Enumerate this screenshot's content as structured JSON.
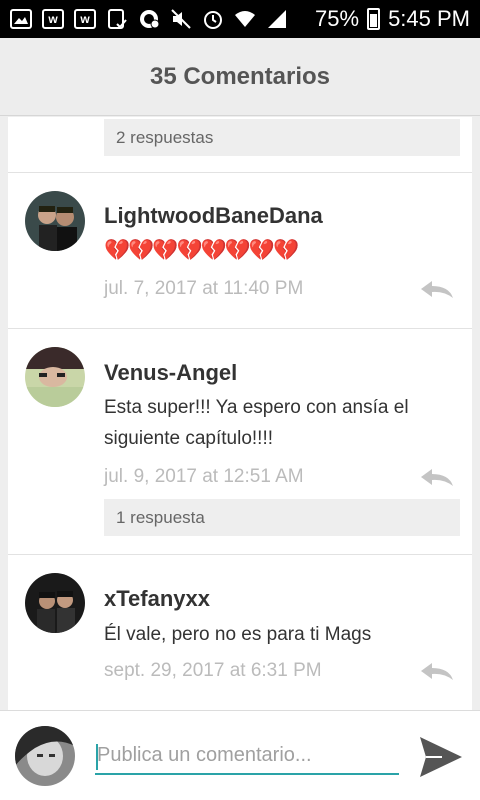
{
  "status_bar": {
    "battery": "75%",
    "time": "5:45 PM",
    "icons": [
      "image-icon",
      "wattpad-icon",
      "wattpad-icon",
      "clipboard-check-icon",
      "whatsapp-icon",
      "mute-icon",
      "alarm-icon",
      "wifi-icon",
      "signal-icon",
      "battery-icon"
    ]
  },
  "header": {
    "title": "35 Comentarios"
  },
  "comments": [
    {
      "replies": "2 respuestas"
    },
    {
      "username": "LightwoodBaneDana",
      "text": "💔💔💔💔💔💔💔💔",
      "timestamp": "jul. 7, 2017 at 11:40 PM"
    },
    {
      "username": "Venus-Angel",
      "text_line1": "Esta super!!! Ya espero con ansía el",
      "text_line2": "siguiente capítulo!!!!",
      "timestamp": "jul. 9, 2017 at 12:51 AM",
      "replies": "1 respuesta"
    },
    {
      "username": "xTefanyxx",
      "text": "Él vale, pero no es para ti Mags",
      "timestamp": "sept. 29, 2017 at 6:31 PM"
    }
  ],
  "composer": {
    "placeholder": "Publica un comentario..."
  },
  "colors": {
    "accent": "#2aa3a8",
    "timestamp": "#bbbbbb",
    "heart": "#e8338a"
  }
}
